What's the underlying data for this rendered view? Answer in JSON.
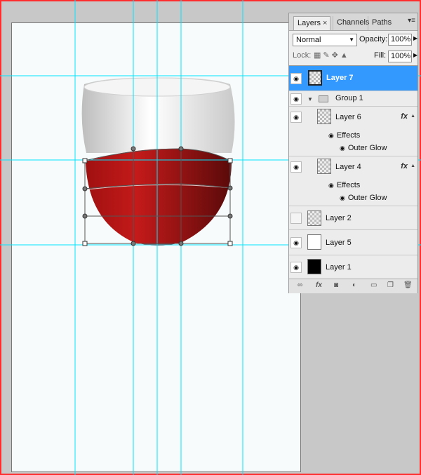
{
  "layers_panel": {
    "tabs": [
      {
        "label": "Layers",
        "close": "×"
      },
      {
        "label": "Channels"
      },
      {
        "label": "Paths"
      }
    ],
    "blend_mode": "Normal",
    "opacity_label": "Opacity:",
    "opacity_value": "100%",
    "lock_label": "Lock:",
    "fill_label": "Fill:",
    "fill_value": "100%",
    "layers": [
      {
        "name": "Layer 7",
        "visible": true,
        "selected": true
      },
      {
        "name": "Group 1",
        "visible": true
      },
      {
        "name": "Layer 6",
        "visible": true,
        "fx": "fx",
        "effects_label": "Effects",
        "effect": "Outer Glow"
      },
      {
        "name": "Layer 4",
        "visible": true,
        "fx": "fx",
        "effects_label": "Effects",
        "effect": "Outer Glow"
      },
      {
        "name": "Layer 2",
        "visible": false
      },
      {
        "name": "Layer 5",
        "visible": true
      },
      {
        "name": "Layer 1",
        "visible": true
      }
    ]
  },
  "colors": {
    "selection": "#3399ff",
    "guide": "#00e5ff",
    "wine_dark": "#6e0c0c",
    "wine_light": "#c41a1a",
    "frame": "#ff2d2d"
  },
  "icons": {
    "eye": "eye-icon",
    "lock_transparent": "lock-transparent-icon",
    "lock_paint": "brush-icon",
    "lock_move": "move-icon",
    "lock_all": "lock-icon",
    "folder": "folder-icon",
    "footer": [
      "link-icon",
      "fx-icon",
      "mask-icon",
      "adjustment-icon",
      "new-group-icon",
      "new-layer-icon",
      "trash-icon"
    ]
  }
}
